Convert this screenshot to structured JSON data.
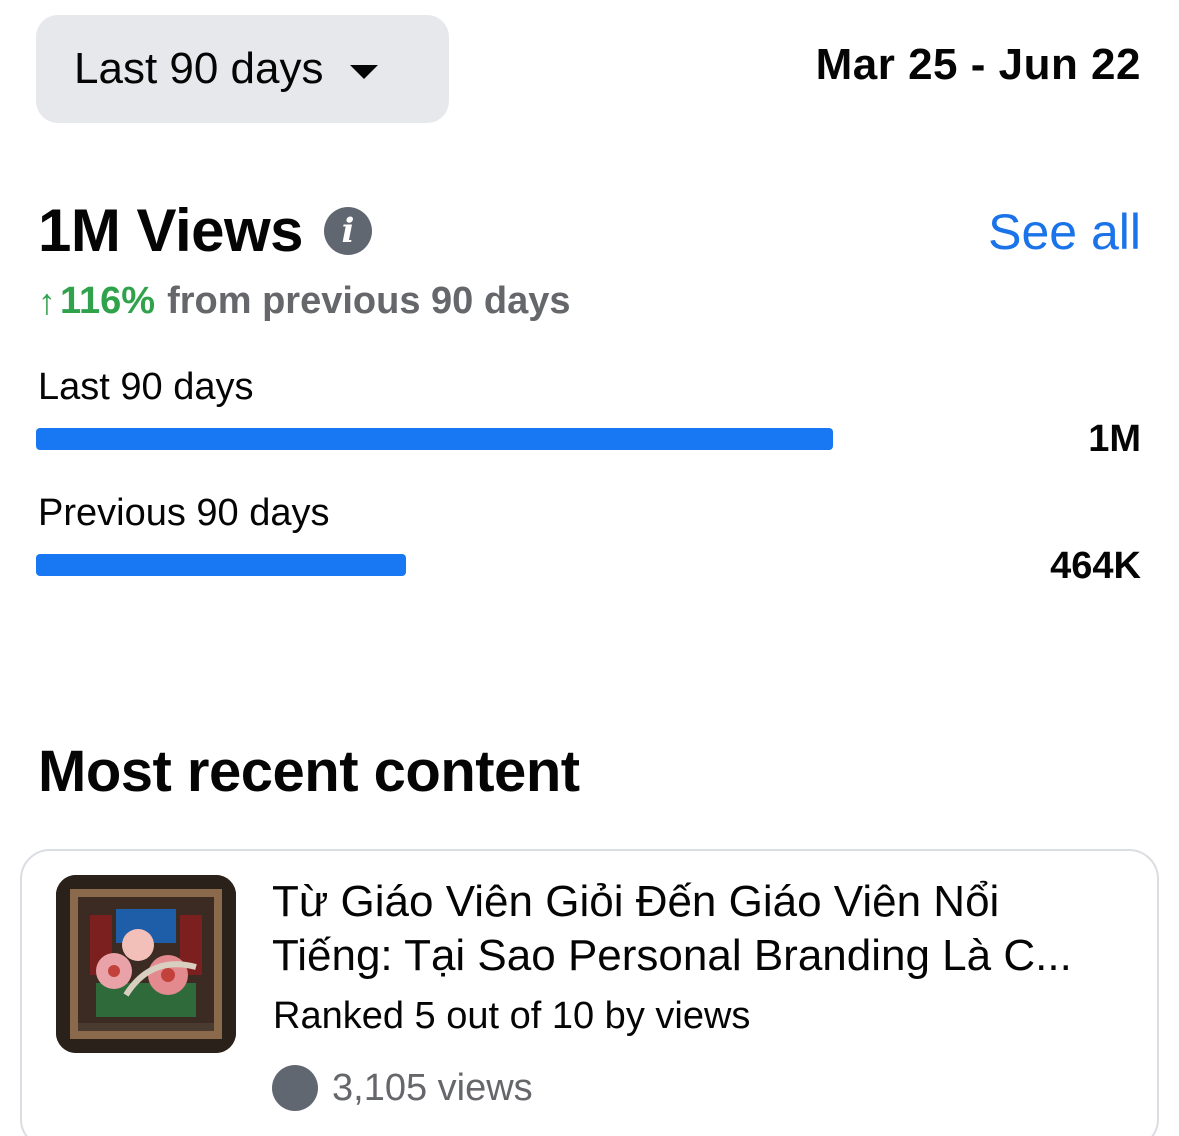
{
  "range_selector": {
    "label": "Last 90 days",
    "icon": "caret-down-icon"
  },
  "date_range": "Mar 25 - Jun 22",
  "views": {
    "title": "1M Views",
    "info_icon": "info-icon",
    "see_all_label": "See all",
    "delta_arrow": "↑",
    "delta_percent": "116%",
    "delta_text": "from previous 90 days",
    "accent_color": "#1877f2",
    "positive_color": "#31a24c"
  },
  "comparison": [
    {
      "label": "Last 90 days",
      "value_text": "1M",
      "value": 1000000
    },
    {
      "label": "Previous 90 days",
      "value_text": "464K",
      "value": 464000
    }
  ],
  "recent_content": {
    "section_title": "Most recent content",
    "item": {
      "title": "Từ Giáo Viên Giỏi Đến Giáo Viên Nổi Tiếng: Tại Sao Personal Branding Là C...",
      "rank_text": "Ranked 5 out of 10 by views",
      "views_text": "3,105 views"
    }
  }
}
